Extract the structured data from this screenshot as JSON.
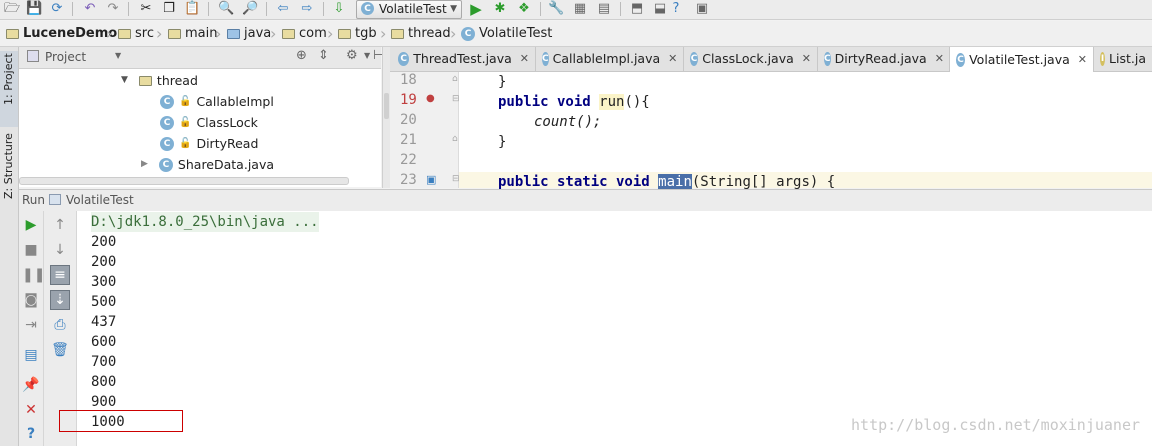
{
  "toolbar": {
    "run_config": "VolatileTest"
  },
  "breadcrumb": [
    "LuceneDemo",
    "src",
    "main",
    "java",
    "com",
    "tgb",
    "thread",
    "VolatileTest"
  ],
  "side_tabs": {
    "project": "1: Project",
    "structure": "Z: Structure"
  },
  "project_panel": {
    "title": "Project",
    "tree": [
      {
        "label": "thread",
        "type": "folder"
      },
      {
        "label": "CallableImpl",
        "type": "class"
      },
      {
        "label": "ClassLock",
        "type": "class"
      },
      {
        "label": "DirtyRead",
        "type": "class"
      },
      {
        "label": "ShareData.java",
        "type": "class"
      }
    ]
  },
  "editor": {
    "tabs": [
      "ThreadTest.java",
      "CallableImpl.java",
      "ClassLock.java",
      "DirtyRead.java",
      "VolatileTest.java",
      "List.ja"
    ],
    "active_tab": "VolatileTest.java",
    "line_numbers": [
      "18",
      "19",
      "20",
      "21",
      "22",
      "23"
    ],
    "code": {
      "l18": "}",
      "l19_kw": "public void ",
      "l19_name": "run",
      "l19_rest": "(){",
      "l20": "count();",
      "l21": "}",
      "l23_kw": "public static void ",
      "l23_name": "main",
      "l23_rest": "(String[] args) {"
    }
  },
  "run_panel": {
    "label": "Run",
    "config": "VolatileTest",
    "command": "D:\\jdk1.8.0_25\\bin\\java ...",
    "output": [
      "200",
      "200",
      "300",
      "500",
      "437",
      "600",
      "700",
      "800",
      "900",
      "1000"
    ],
    "highlighted_value": "1000"
  },
  "watermark": "http://blog.csdn.net/moxinjuaner",
  "colors": {
    "run_green": "#2c9c2c",
    "highlight_box": "#cc0000",
    "active_tab": "#ffffff",
    "caret_line": "#fbf7e4"
  }
}
